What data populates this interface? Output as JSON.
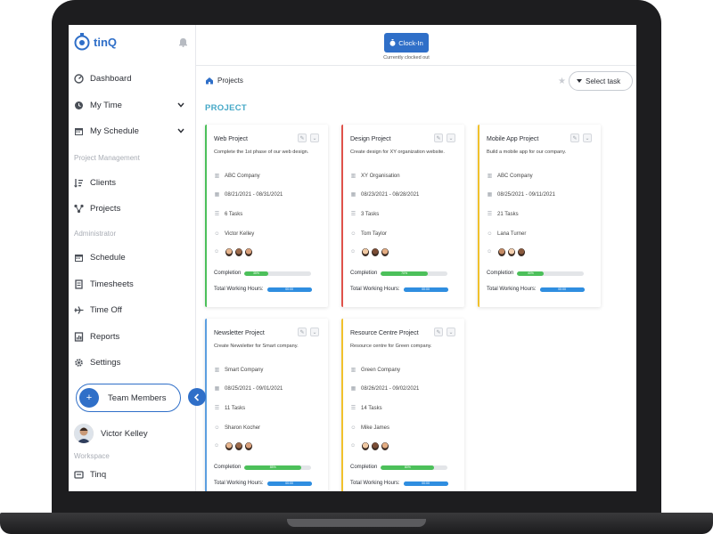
{
  "app": {
    "name": "tinQ"
  },
  "sidebar": {
    "items": [
      {
        "label": "Dashboard",
        "icon": "dashboard-icon"
      },
      {
        "label": "My Time",
        "icon": "clock-icon"
      },
      {
        "label": "My Schedule",
        "icon": "calendar-icon"
      },
      {
        "label": "Clients",
        "icon": "list-icon"
      },
      {
        "label": "Projects",
        "icon": "network-icon"
      },
      {
        "label": "Schedule",
        "icon": "calendar-icon"
      },
      {
        "label": "Timesheets",
        "icon": "document-icon"
      },
      {
        "label": "Time Off",
        "icon": "plane-icon"
      },
      {
        "label": "Reports",
        "icon": "report-icon"
      },
      {
        "label": "Settings",
        "icon": "gear-icon"
      }
    ],
    "sections": {
      "project_management": "Project Management",
      "administrator": "Administrator",
      "workspace": "Workspace"
    },
    "team_members_label": "Team Members",
    "user_name": "Victor Kelley",
    "workspace_item": "Tinq"
  },
  "topbar": {
    "clock_in_label": "Clock-In",
    "clock_status": "Currently clocked out"
  },
  "breadcrumb": {
    "label": "Projects"
  },
  "select_task": {
    "label": "Select task"
  },
  "page_heading": "PROJECT",
  "colors": {
    "accent": "#2f6fc8",
    "heading": "#45a8c7",
    "green": "#4cc05a",
    "red": "#e0524b",
    "yellow": "#f1c12c",
    "blue": "#5b9ee0"
  },
  "projects": [
    {
      "title": "Web Project",
      "description": "Complete the 1st phase of our web design.",
      "client": "ABC Company",
      "dates": "08/21/2021 - 08/31/2021",
      "tasks": "6 Tasks",
      "owner": "Victor Kelley",
      "completion_label": "Completion",
      "completion": 0.35,
      "completion_text": "35%",
      "hours_label": "Total Working Hours:",
      "hours_text": "00:00",
      "accent": "#4cc05a"
    },
    {
      "title": "Design Project",
      "description": "Create design for XY organization website.",
      "client": "XY Organisation",
      "dates": "08/23/2021 - 08/28/2021",
      "tasks": "3 Tasks",
      "owner": "Tom Taylor",
      "completion_label": "Completion",
      "completion": 0.7,
      "completion_text": "70%",
      "hours_label": "Total Working Hours:",
      "hours_text": "00:00",
      "accent": "#e0524b"
    },
    {
      "title": "Mobile App Project",
      "description": "Build a mobile app for our company.",
      "client": "ABC Company",
      "dates": "08/25/2021 - 09/11/2021",
      "tasks": "21 Tasks",
      "owner": "Lana Turner",
      "completion_label": "Completion",
      "completion": 0.4,
      "completion_text": "40%",
      "hours_label": "Total Working Hours:",
      "hours_text": "00:00",
      "accent": "#f1c12c"
    },
    {
      "title": "Newsletter Project",
      "description": "Create Newsletter for Smart company.",
      "client": "Smart Company",
      "dates": "08/25/2021 - 09/01/2021",
      "tasks": "11 Tasks",
      "owner": "Sharon Kocher",
      "completion_label": "Completion",
      "completion": 0.85,
      "completion_text": "85%",
      "hours_label": "Total Working Hours:",
      "hours_text": "00:00",
      "accent": "#5b9ee0"
    },
    {
      "title": "Resource Centre Project",
      "description": "Resource centre for Green company.",
      "client": "Green Company",
      "dates": "08/26/2021 - 09/02/2021",
      "tasks": "14 Tasks",
      "owner": "Mike James",
      "completion_label": "Completion",
      "completion": 0.8,
      "completion_text": "80%",
      "hours_label": "Total Working Hours:",
      "hours_text": "00:00",
      "accent": "#f1c12c"
    }
  ]
}
